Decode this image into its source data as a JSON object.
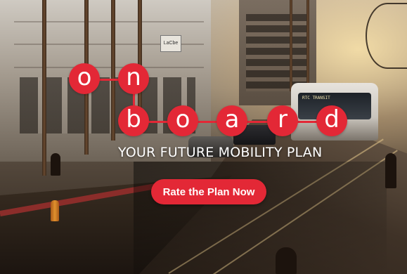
{
  "hero": {
    "logo_letters_top": [
      "o",
      "n"
    ],
    "logo_letters_bottom": [
      "b",
      "o",
      "a",
      "r",
      "d"
    ],
    "tagline": "YOUR FUTURE MOBILITY PLAN",
    "cta_label": "Rate the Plan Now",
    "bus_destination": "RTC TRANSIT",
    "store_sign": "LaCbe"
  },
  "colors": {
    "brand_red": "#e32836",
    "text": "#ffffff"
  }
}
